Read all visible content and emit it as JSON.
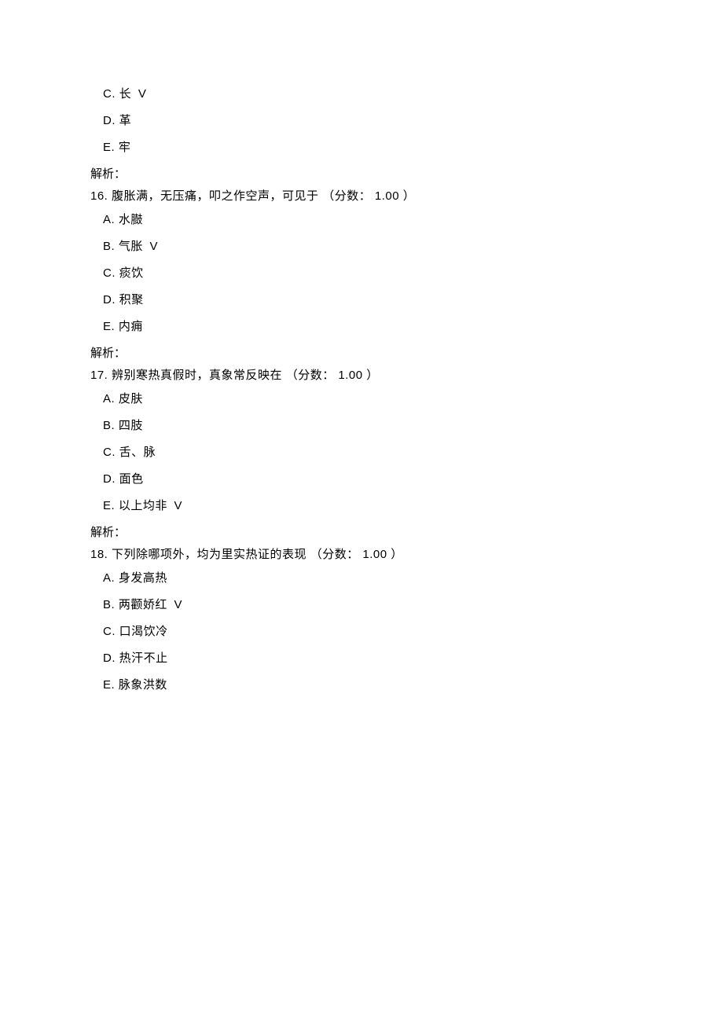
{
  "preOptions": {
    "C": {
      "letter": "C.",
      "text": "长",
      "mark": "V"
    },
    "D": {
      "letter": "D.",
      "text": "革"
    },
    "E": {
      "letter": "E.",
      "text": "牢"
    }
  },
  "preAnalysis": "解析：",
  "q16": {
    "number": "16.",
    "stem": "腹胀满，无压痛，叩之作空声，可见于 （分数：",
    "score": "1.00",
    "close": "）",
    "options": {
      "A": {
        "letter": "A.",
        "text": "水臌"
      },
      "B": {
        "letter": "B.",
        "text": "气胀",
        "mark": "V"
      },
      "C": {
        "letter": "C.",
        "text": "痰饮"
      },
      "D": {
        "letter": "D.",
        "text": "积聚"
      },
      "E": {
        "letter": "E.",
        "text": "内痈"
      }
    },
    "analysis": "解析："
  },
  "q17": {
    "number": "17.",
    "stem": "辨别寒热真假时，真象常反映在 （分数：",
    "score": "1.00",
    "close": "）",
    "options": {
      "A": {
        "letter": "A.",
        "text": "皮肤"
      },
      "B": {
        "letter": "B.",
        "text": "四肢"
      },
      "C": {
        "letter": "C.",
        "text": "舌、脉"
      },
      "D": {
        "letter": "D.",
        "text": "面色"
      },
      "E": {
        "letter": "E.",
        "text": "以上均非",
        "mark": "V"
      }
    },
    "analysis": "解析："
  },
  "q18": {
    "number": "18.",
    "stem": "下列除哪项外，均为里实热证的表现 （分数：",
    "score": "1.00",
    "close": "）",
    "options": {
      "A": {
        "letter": "A.",
        "text": "身发高热"
      },
      "B": {
        "letter": "B.",
        "text": "两颧娇红",
        "mark": "V"
      },
      "C": {
        "letter": "C.",
        "text": "口渴饮冷"
      },
      "D": {
        "letter": "D.",
        "text": "热汗不止"
      },
      "E": {
        "letter": "E.",
        "text": "脉象洪数"
      }
    }
  }
}
